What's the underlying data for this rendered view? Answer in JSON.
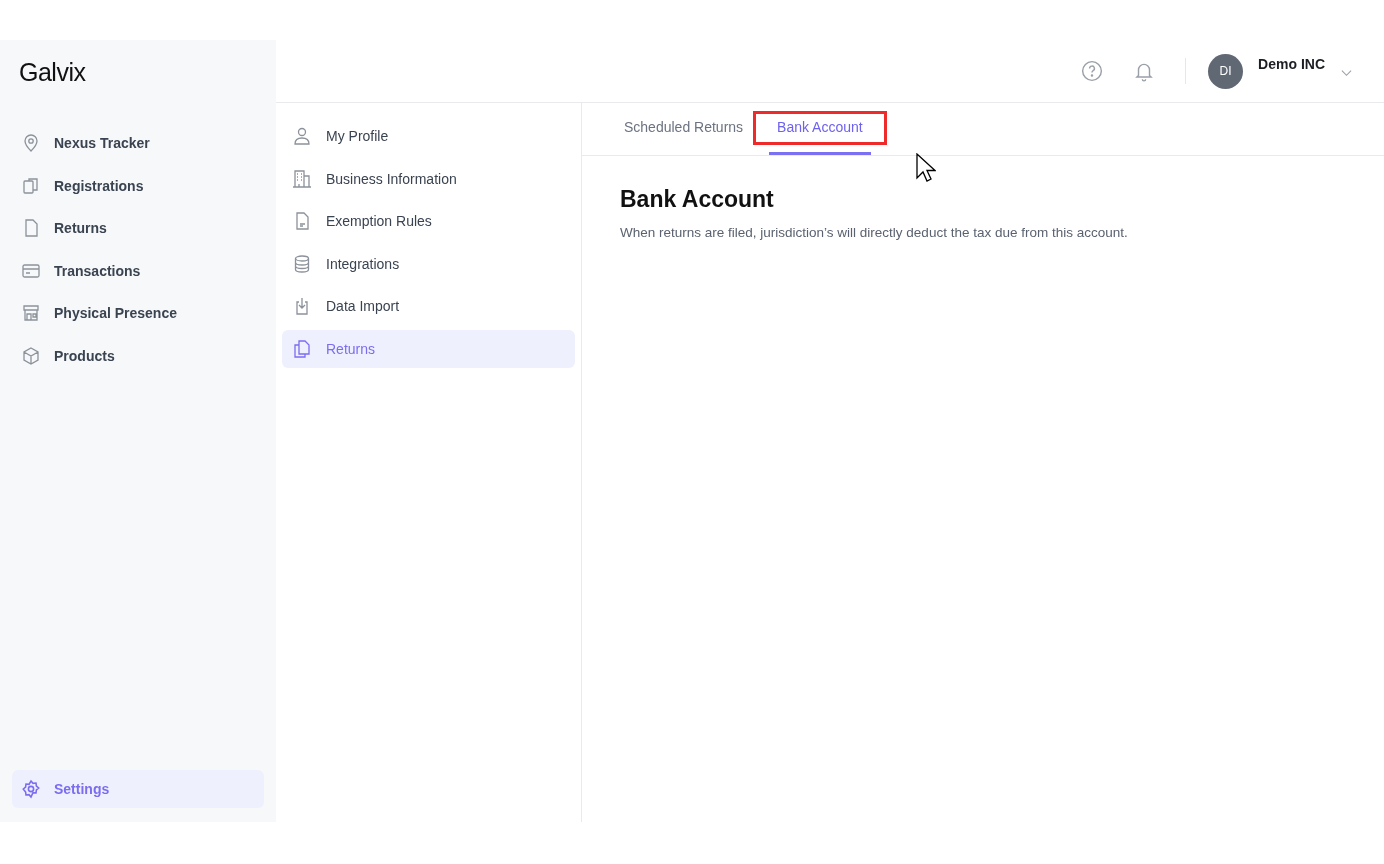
{
  "sidebar": {
    "logo": "Galvix",
    "items": [
      {
        "label": "Nexus Tracker",
        "selected": false
      },
      {
        "label": "Registrations",
        "selected": false
      },
      {
        "label": "Returns",
        "selected": false
      },
      {
        "label": "Transactions",
        "selected": false
      },
      {
        "label": "Physical Presence",
        "selected": false
      },
      {
        "label": "Products",
        "selected": false
      }
    ],
    "footer_item": {
      "label": "Settings",
      "selected": true
    }
  },
  "header": {
    "avatar_initials": "DI",
    "account_name": "Demo INC"
  },
  "settings_nav": [
    {
      "label": "My Profile",
      "selected": false
    },
    {
      "label": "Business Information",
      "selected": false
    },
    {
      "label": "Exemption Rules",
      "selected": false
    },
    {
      "label": "Integrations",
      "selected": false
    },
    {
      "label": "Data Import",
      "selected": false
    },
    {
      "label": "Returns",
      "selected": true
    }
  ],
  "tabs": [
    {
      "label": "Scheduled Returns",
      "selected": false,
      "highlighted": false
    },
    {
      "label": "Bank Account",
      "selected": true,
      "highlighted": true
    }
  ],
  "content": {
    "title": "Bank Account",
    "description": "When returns are filed, jurisdiction’s will directly deduct the tax due from this account."
  }
}
